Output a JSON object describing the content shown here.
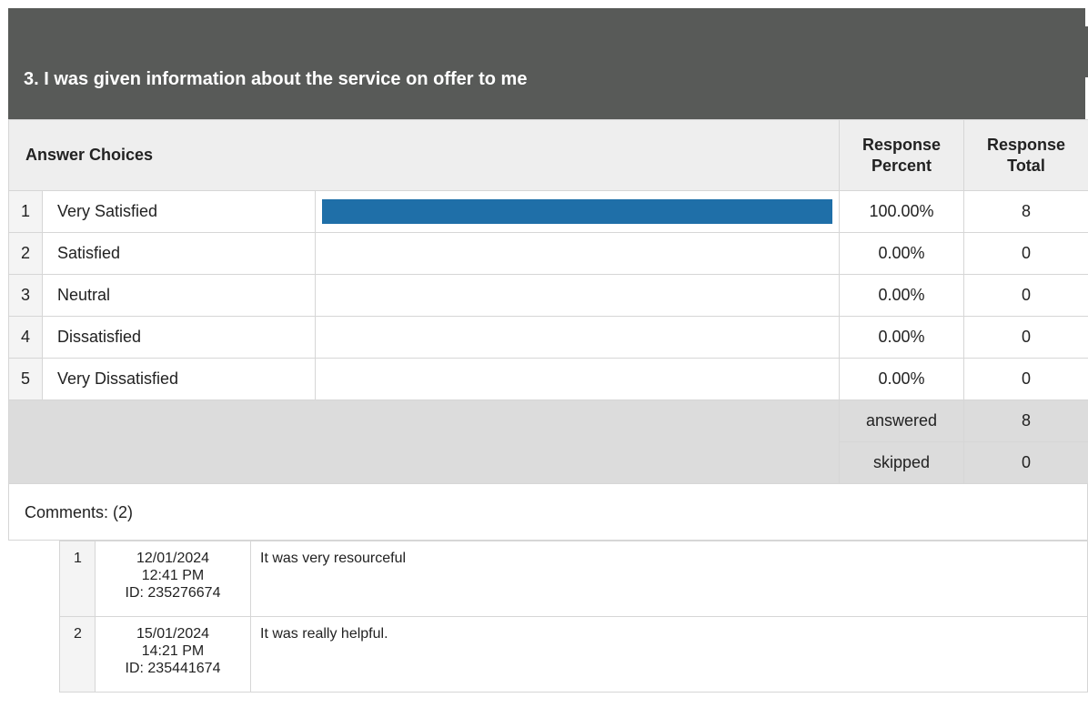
{
  "question": {
    "title": "3. I was given information about the service on offer to me"
  },
  "table": {
    "header_choices": "Answer Choices",
    "header_percent_line1": "Response",
    "header_percent_line2": "Percent",
    "header_total_line1": "Response",
    "header_total_line2": "Total",
    "rows": [
      {
        "num": "1",
        "label": "Very Satisfied",
        "fraction": 1.0,
        "percent": "100.00%",
        "total": "8"
      },
      {
        "num": "2",
        "label": "Satisfied",
        "fraction": 0.0,
        "percent": "0.00%",
        "total": "0"
      },
      {
        "num": "3",
        "label": "Neutral",
        "fraction": 0.0,
        "percent": "0.00%",
        "total": "0"
      },
      {
        "num": "4",
        "label": "Dissatisfied",
        "fraction": 0.0,
        "percent": "0.00%",
        "total": "0"
      },
      {
        "num": "5",
        "label": "Very Dissatisfied",
        "fraction": 0.0,
        "percent": "0.00%",
        "total": "0"
      }
    ],
    "answered_label": "answered",
    "answered_value": "8",
    "skipped_label": "skipped",
    "skipped_value": "0"
  },
  "comments": {
    "heading": "Comments: (2)",
    "items": [
      {
        "num": "1",
        "date": "12/01/2024",
        "time": "12:41 PM",
        "id": "ID: 235276674",
        "text": "It was very resourceful"
      },
      {
        "num": "2",
        "date": "15/01/2024",
        "time": "14:21 PM",
        "id": "ID: 235441674",
        "text": "It was really helpful."
      }
    ]
  },
  "colors": {
    "header_bg": "#585a58",
    "bar": "#1f6fa8",
    "summary_bg": "#dcdcdc"
  }
}
